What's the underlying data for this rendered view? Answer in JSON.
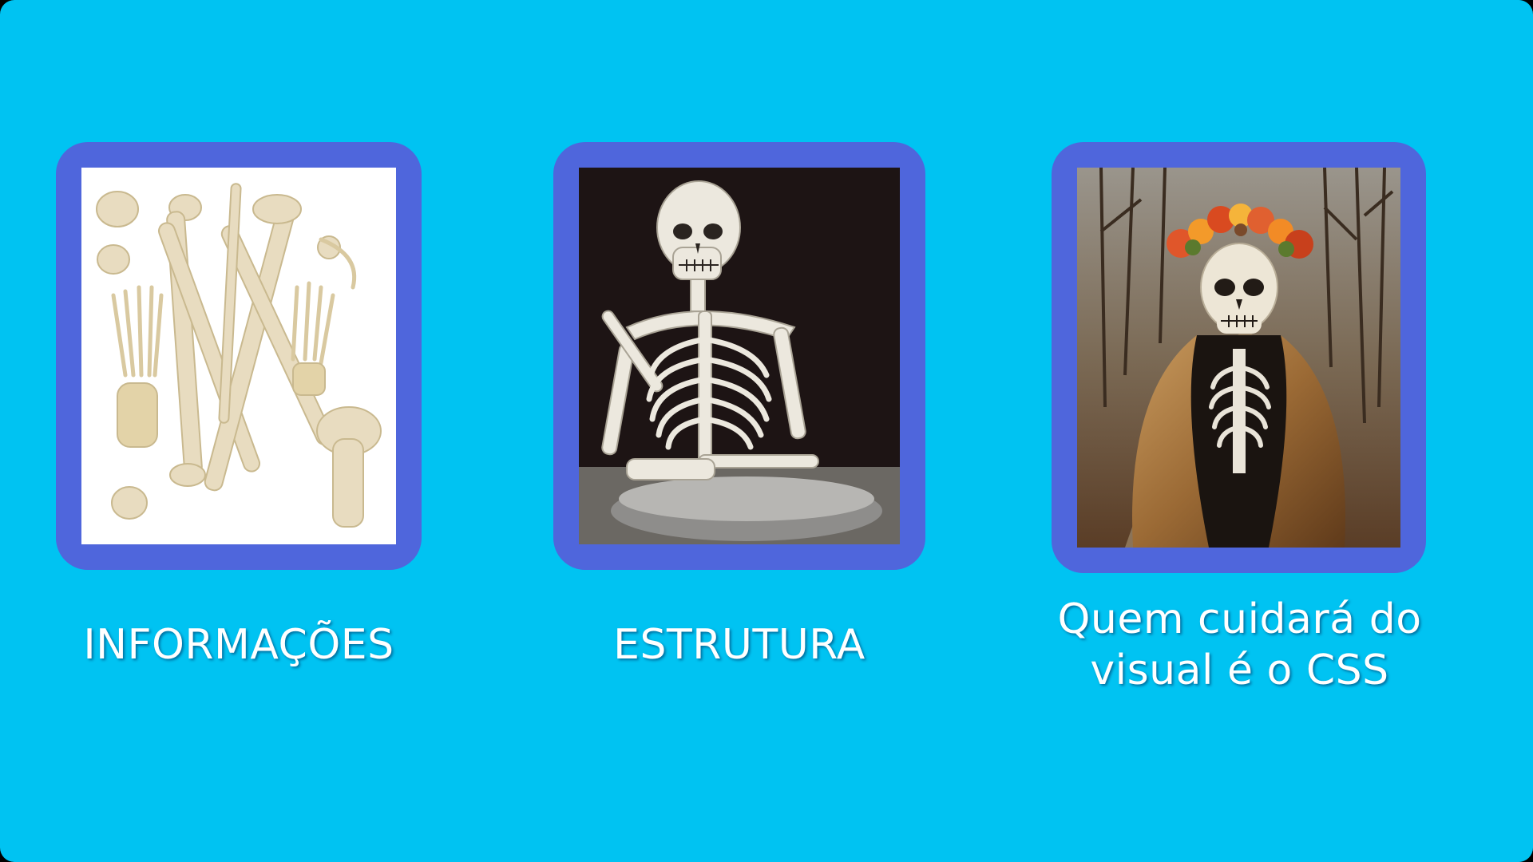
{
  "colors": {
    "background": "#00c3f2",
    "card_frame": "#4f66dc",
    "caption_text": "#ffffff"
  },
  "cards": [
    {
      "caption": "INFORMAÇÕES",
      "image": "scattered-bones-photo"
    },
    {
      "caption": "ESTRUTURA",
      "image": "posed-skeleton-photo"
    },
    {
      "caption_line1": "Quem cuidará do",
      "caption_line2": "visual é o CSS",
      "image": "dressed-skeleton-photo"
    }
  ]
}
